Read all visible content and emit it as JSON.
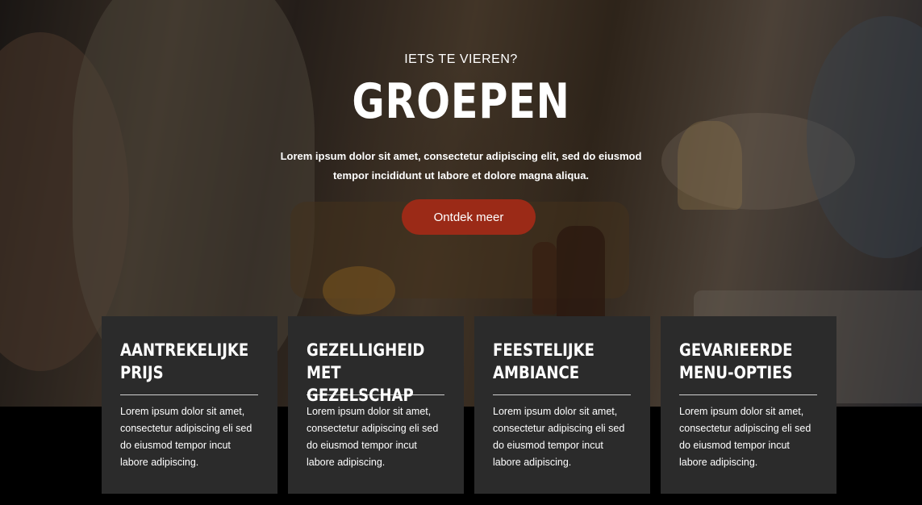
{
  "hero": {
    "eyebrow": "IETS TE VIEREN?",
    "title": "GROEPEN",
    "intro": "Lorem ipsum dolor sit amet, consectetur adipiscing elit, sed do eiusmod tempor incididunt ut labore et dolore magna aliqua.",
    "cta_label": "Ontdek meer",
    "accent_color": "#9b2a17"
  },
  "features": [
    {
      "title": "AANTREKELIJKE PRIJS",
      "text": "Lorem ipsum dolor sit amet, consectetur adipiscing eli sed do eiusmod tempor incut labore adipiscing."
    },
    {
      "title": "GEZELLIGHEID MET GEZELSCHAP",
      "text": "Lorem ipsum dolor sit amet, consectetur adipiscing eli sed do eiusmod tempor incut labore adipiscing."
    },
    {
      "title": "FEESTELIJKE AMBIANCE",
      "text": "Lorem ipsum dolor sit amet, consectetur adipiscing eli sed do eiusmod tempor incut labore adipiscing."
    },
    {
      "title": "GEVARIEERDE MENU-OPTIES",
      "text": "Lorem ipsum dolor sit amet, consectetur adipiscing eli sed do eiusmod tempor incut labore adipiscing."
    }
  ]
}
